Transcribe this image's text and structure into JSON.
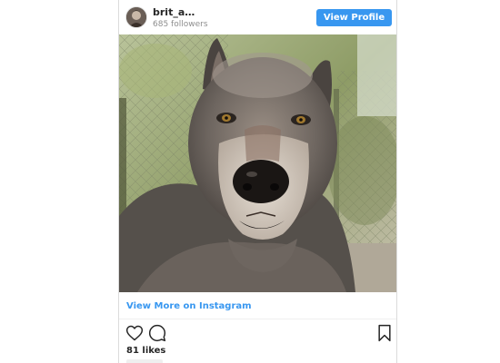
{
  "profile": {
    "username": "brit_a…",
    "followers": "685 followers",
    "view_profile_label": "View Profile"
  },
  "post": {
    "image_description_icon": "wolf-photo",
    "view_more_label": "View More on Instagram",
    "likes": "81 likes"
  },
  "icons": {
    "like": "heart-icon",
    "comment": "comment-icon",
    "save": "bookmark-icon"
  },
  "colors": {
    "accent": "#3897f0",
    "text": "#262626",
    "muted": "#8e8e8e"
  }
}
